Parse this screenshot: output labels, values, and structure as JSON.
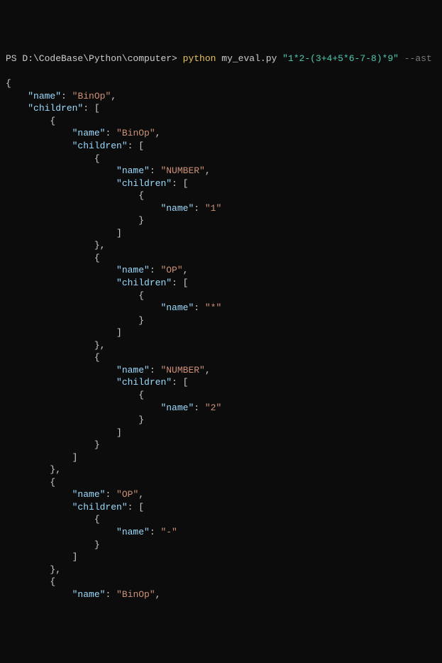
{
  "prompt": {
    "ps_prefix": "PS ",
    "cwd": "D:\\CodeBase\\Python\\computer",
    "sep": "> ",
    "command": "python",
    "script": "my_eval.py",
    "arg_quoted": "\"1*2-(3+4+5*6-7-8)*9\"",
    "flag": "--ast"
  },
  "json_output": {
    "l00": "{",
    "l01": "    \"name\": \"BinOp\",",
    "l02": "    \"children\": [",
    "l03": "        {",
    "l04": "            \"name\": \"BinOp\",",
    "l05": "            \"children\": [",
    "l06": "                {",
    "l07": "                    \"name\": \"NUMBER\",",
    "l08": "                    \"children\": [",
    "l09": "                        {",
    "l10": "                            \"name\": \"1\"",
    "l11": "                        }",
    "l12": "                    ]",
    "l13": "                },",
    "l14": "                {",
    "l15": "                    \"name\": \"OP\",",
    "l16": "                    \"children\": [",
    "l17": "                        {",
    "l18": "                            \"name\": \"*\"",
    "l19": "                        }",
    "l20": "                    ]",
    "l21": "                },",
    "l22": "                {",
    "l23": "                    \"name\": \"NUMBER\",",
    "l24": "                    \"children\": [",
    "l25": "                        {",
    "l26": "                            \"name\": \"2\"",
    "l27": "                        }",
    "l28": "                    ]",
    "l29": "                }",
    "l30": "            ]",
    "l31": "        },",
    "l32": "        {",
    "l33": "            \"name\": \"OP\",",
    "l34": "            \"children\": [",
    "l35": "                {",
    "l36": "                    \"name\": \"-\"",
    "l37": "                }",
    "l38": "            ]",
    "l39": "        },",
    "l40": "        {",
    "l41": "            \"name\": \"BinOp\","
  }
}
